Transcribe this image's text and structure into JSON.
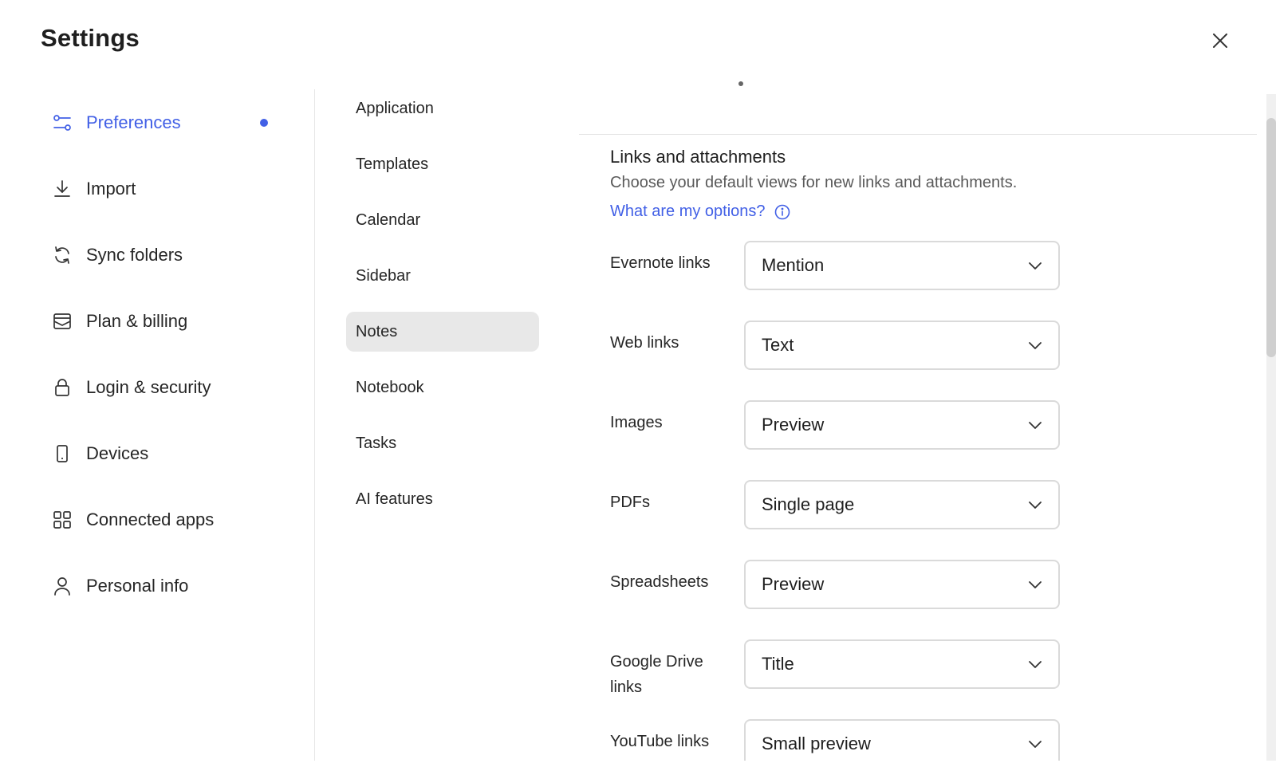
{
  "dialog": {
    "title": "Settings"
  },
  "colors": {
    "accent": "#4260e6",
    "active_bg": "#e8e8e8",
    "border": "#dadada"
  },
  "leftnav": {
    "items": [
      {
        "label": "Preferences",
        "icon": "sliders-icon",
        "active": true
      },
      {
        "label": "Import",
        "icon": "download-icon"
      },
      {
        "label": "Sync folders",
        "icon": "sync-icon"
      },
      {
        "label": "Plan & billing",
        "icon": "billing-icon"
      },
      {
        "label": "Login & security",
        "icon": "lock-icon"
      },
      {
        "label": "Devices",
        "icon": "device-icon"
      },
      {
        "label": "Connected apps",
        "icon": "apps-grid-icon"
      },
      {
        "label": "Personal info",
        "icon": "person-icon"
      }
    ]
  },
  "subnav": {
    "items": [
      {
        "label": "Application"
      },
      {
        "label": "Templates"
      },
      {
        "label": "Calendar"
      },
      {
        "label": "Sidebar"
      },
      {
        "label": "Notes",
        "active": true
      },
      {
        "label": "Notebook"
      },
      {
        "label": "Tasks"
      },
      {
        "label": "AI features"
      }
    ]
  },
  "section": {
    "title": "Links and attachments",
    "description": "Choose your default views for new links and attachments.",
    "options_link": "What are my options?"
  },
  "settings": [
    {
      "label": "Evernote links",
      "value": "Mention"
    },
    {
      "label": "Web links",
      "value": "Text"
    },
    {
      "label": "Images",
      "value": "Preview"
    },
    {
      "label": "PDFs",
      "value": "Single page"
    },
    {
      "label": "Spreadsheets",
      "value": "Preview"
    },
    {
      "label": "Google Drive links",
      "value": "Title"
    },
    {
      "label": "YouTube links",
      "value": "Small preview"
    }
  ]
}
